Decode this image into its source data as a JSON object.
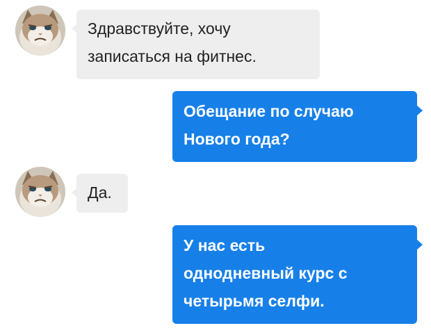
{
  "messages": [
    {
      "direction": "incoming",
      "avatar": "grumpy-cat-avatar",
      "text": "Здравствуйте, хочу\nзаписаться на фитнес."
    },
    {
      "direction": "outgoing",
      "text": "Обещание по случаю\nНового года?"
    },
    {
      "direction": "incoming",
      "avatar": "grumpy-cat-avatar",
      "text": "Да."
    },
    {
      "direction": "outgoing",
      "text": "У нас есть\nоднодневный курс с\nчетырьмя селфи."
    }
  ],
  "colors": {
    "incoming_bubble": "#eeeeee",
    "incoming_text": "#222222",
    "outgoing_bubble": "#1780e8",
    "outgoing_text": "#ffffff",
    "background": "#ffffff"
  }
}
